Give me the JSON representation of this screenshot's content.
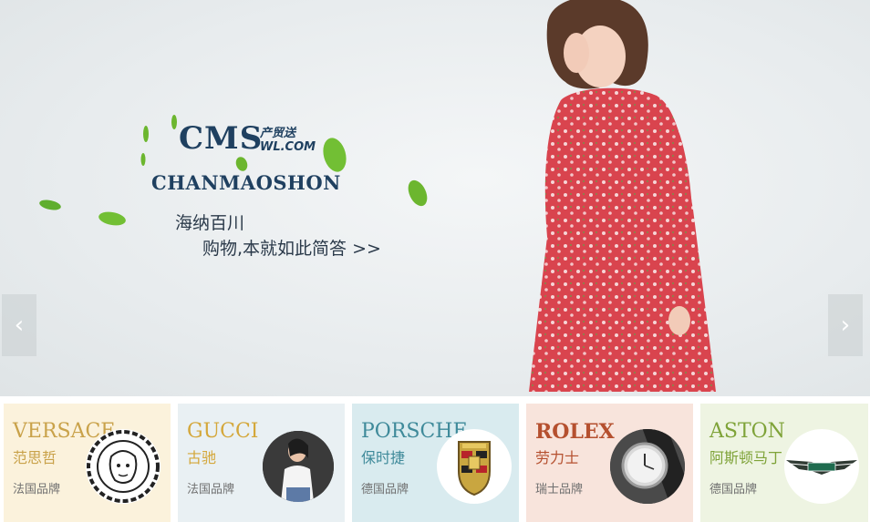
{
  "banner": {
    "brand_mark": "CMS",
    "brand_sub_cn": "产贸送",
    "brand_sub_domain": "WL.COM",
    "brand_name": "CHANMAOSHON",
    "slogan_line1": "海纳百川",
    "slogan_line2": "购物,本就如此简答 >>",
    "prev_arrow": "‹",
    "next_arrow": "›"
  },
  "brands": [
    {
      "name_en": "VERSACE",
      "name_cn": "范思哲",
      "origin": "法国品牌",
      "bg": "#fbf2dc",
      "accent": "#c9a24a",
      "logo": "medusa-logo"
    },
    {
      "name_en": "GUCCI",
      "name_cn": "古驰",
      "origin": "法国品牌",
      "bg": "#e9f0f3",
      "accent": "#d4a73a",
      "logo": "model-photo"
    },
    {
      "name_en": "PORSCHE",
      "name_cn": "保时捷",
      "origin": "德国品牌",
      "bg": "#d9ebef",
      "accent": "#3f8a9a",
      "logo": "porsche-crest"
    },
    {
      "name_en": "ROLEX",
      "name_cn": "劳力士",
      "origin": "瑞士品牌",
      "bg": "#f8e4dc",
      "accent": "#b5502f",
      "logo": "watch-photo"
    },
    {
      "name_en": "ASTON",
      "name_cn": "阿斯顿马丁",
      "origin": "德国品牌",
      "bg": "#eef4e2",
      "accent": "#7fa339",
      "logo": "aston-martin-wings"
    }
  ]
}
